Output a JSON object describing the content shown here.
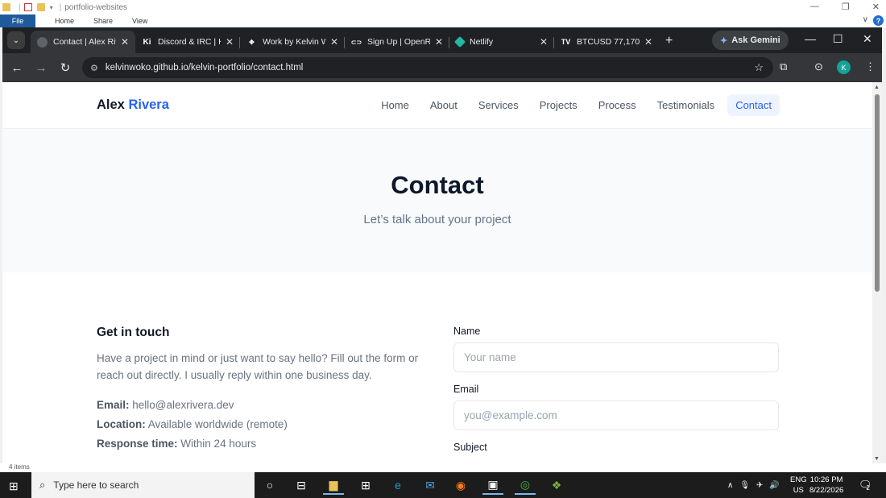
{
  "explorer": {
    "folder_name": "portfolio-websites",
    "ribbon_tabs": [
      "File",
      "Home",
      "Share",
      "View"
    ],
    "status_items": "4 items"
  },
  "browser": {
    "tabs": [
      {
        "title": "Contact | Alex Riv",
        "active": true,
        "favicon": "globe-icon"
      },
      {
        "title": "Discord & IRC | K",
        "active": false,
        "favicon": "ki-icon"
      },
      {
        "title": "Work by Kelvin W",
        "active": false,
        "favicon": "work-icon"
      },
      {
        "title": "Sign Up | OpenR",
        "active": false,
        "favicon": "openrouter-icon"
      },
      {
        "title": "Netlify",
        "active": false,
        "favicon": "netlify-icon"
      },
      {
        "title": "BTCUSD 77,170",
        "active": false,
        "favicon": "tradingview-icon"
      }
    ],
    "new_tab": "+",
    "gemini_label": "Ask Gemini",
    "url": "kelvinwoko.github.io/kelvin-portfolio/contact.html",
    "profile_initial": "K"
  },
  "site": {
    "brand_first": "Alex",
    "brand_second": "Rivera",
    "nav": [
      "Home",
      "About",
      "Services",
      "Projects",
      "Process",
      "Testimonials",
      "Contact"
    ],
    "active_nav": "Contact",
    "hero_title": "Contact",
    "hero_subtitle": "Let’s talk about your project",
    "get_in_touch_title": "Get in touch",
    "get_in_touch_text": "Have a project in mind or just want to say hello? Fill out the form or reach out directly. I usually reply within one business day.",
    "info": [
      {
        "label": "Email:",
        "value": "hello@alexrivera.dev"
      },
      {
        "label": "Location:",
        "value": "Available worldwide (remote)"
      },
      {
        "label": "Response time:",
        "value": "Within 24 hours"
      }
    ],
    "form": {
      "name_label": "Name",
      "name_placeholder": "Your name",
      "email_label": "Email",
      "email_placeholder": "you@example.com",
      "subject_label": "Subject"
    }
  },
  "taskbar": {
    "search_placeholder": "Type here to search",
    "lang": "ENG",
    "region": "US",
    "time": "10:26 PM",
    "date": "8/22/2026",
    "notification_count": "2"
  }
}
